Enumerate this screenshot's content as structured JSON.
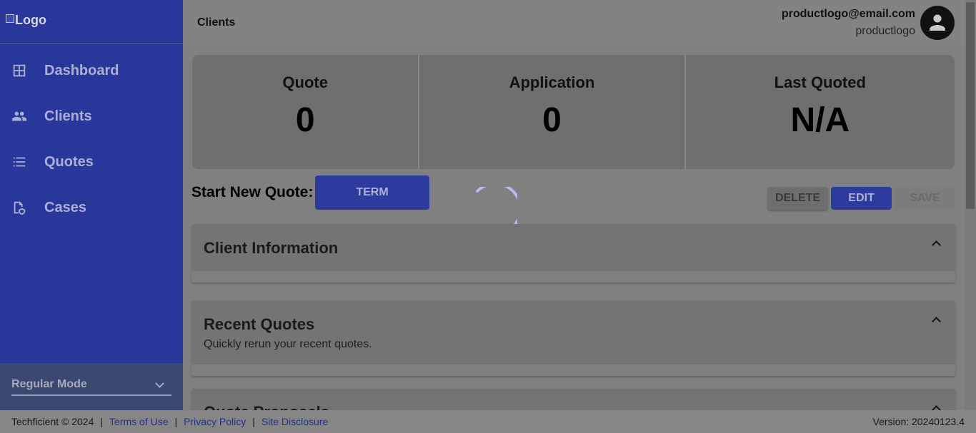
{
  "sidebar": {
    "logo_alt": "Logo",
    "items": [
      {
        "label": "Dashboard",
        "icon": "dashboard-icon"
      },
      {
        "label": "Clients",
        "icon": "clients-icon"
      },
      {
        "label": "Quotes",
        "icon": "list-icon"
      },
      {
        "label": "Cases",
        "icon": "cases-icon"
      }
    ],
    "mode": "Regular Mode"
  },
  "header": {
    "title": "Clients",
    "email": "productlogo@email.com",
    "username": "productlogo"
  },
  "stats": [
    {
      "title": "Quote",
      "value": "0"
    },
    {
      "title": "Application",
      "value": "0"
    },
    {
      "title": "Last Quoted",
      "value": "N/A"
    }
  ],
  "actions": {
    "start_new_quote_label": "Start New Quote:",
    "term": "TERM",
    "delete": "DELETE",
    "edit": "EDIT",
    "save": "SAVE"
  },
  "panels": {
    "client_info": {
      "title": "Client Information"
    },
    "recent_quotes": {
      "title": "Recent Quotes",
      "subtitle": "Quickly rerun your recent quotes."
    },
    "quote_proposals": {
      "title": "Quote Proposals"
    }
  },
  "footer": {
    "copyright": "Techficient © 2024",
    "sep": "|",
    "terms": "Terms of Use",
    "privacy": "Privacy Policy",
    "disclosure": "Site Disclosure",
    "version": "Version: 20240123.4"
  },
  "colors": {
    "sidebar_bg": "#29369a",
    "primary_button": "#2d3a9e",
    "overlay_gray": "#808080"
  }
}
